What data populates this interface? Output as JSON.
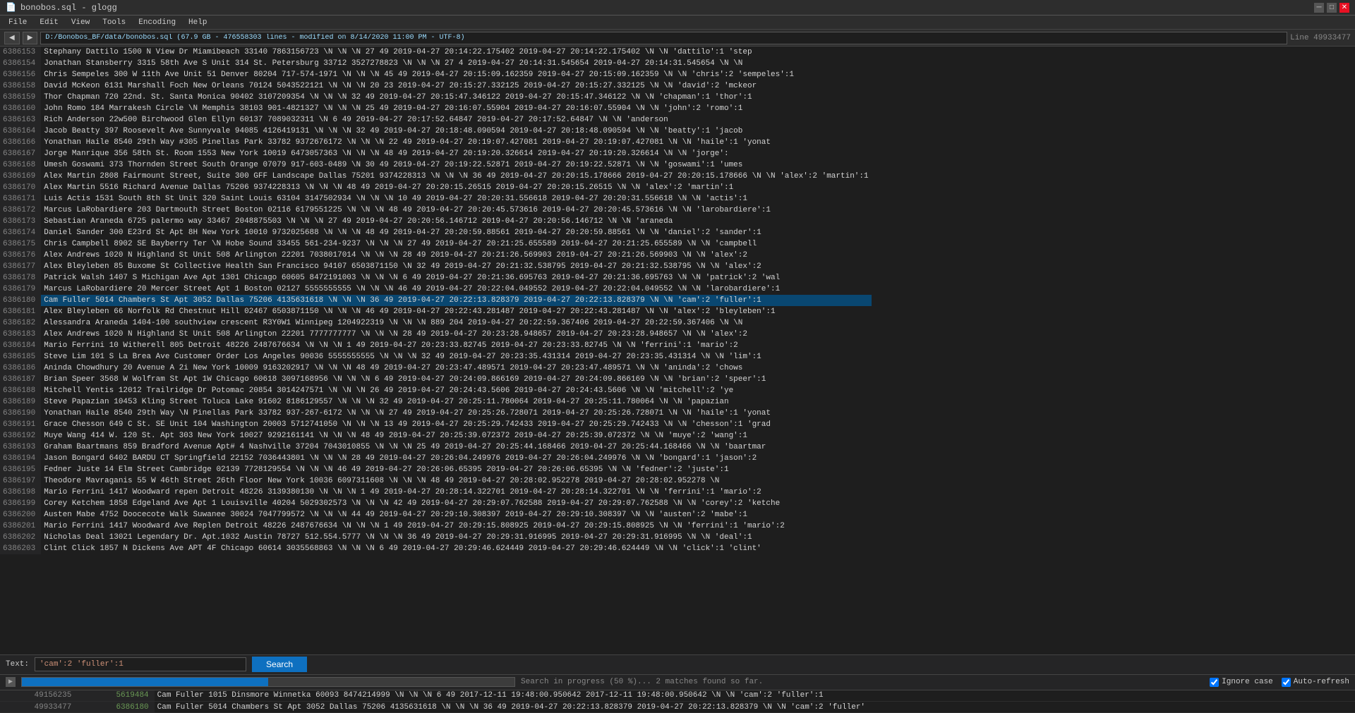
{
  "titleBar": {
    "title": "bonobos.sql - glogg",
    "minimizeLabel": "─",
    "maximizeLabel": "□",
    "closeLabel": "✕"
  },
  "menuBar": {
    "items": [
      "File",
      "Edit",
      "View",
      "Tools",
      "Encoding",
      "Help"
    ]
  },
  "toolbar": {
    "backLabel": "◀",
    "forwardLabel": "▶",
    "filePath": "D:/Bonobos_BF/data/bonobos.sql (67.9 GB - 476558303 lines - modified on 8/14/2020 11:00 PM - UTF-8)",
    "lineInfo": "Line 49933477"
  },
  "tableData": {
    "rows": [
      {
        "lineNum": "6386153",
        "data": "Stephany    Dattilo 1500 N View Dr          Miamibeach       33140   7863156723    \\N    \\N    \\N    27    49    2019-04-27 20:14:22.175402    2019-04-27 20:14:22.175402    \\N    \\N    'dattilo':1 'step"
      },
      {
        "lineNum": "6386154",
        "data": "Jonathan    Stansberry    3315 58th Ave S Unit 314    St. Petersburg    33712   3527278823    \\N    \\N    \\N    27    4    2019-04-27 20:14:31.545654    2019-04-27 20:14:31.545654    \\N    \\N"
      },
      {
        "lineNum": "6386156",
        "data": "Chris    Sempeles    300 W 11th Ave  Unit 51 Denver  80204   717-574-1971    \\N    \\N    \\N    45    49    2019-04-27 20:15:09.162359    2019-04-27 20:15:09.162359    \\N    \\N    'chris':2 'sempeles':1"
      },
      {
        "lineNum": "6386158",
        "data": "David    McKeon  6131 Marshall Foch    New Orleans    70124   5043522121    \\N    \\N    \\N    20    23    2019-04-27 20:15:27.332125    2019-04-27 20:15:27.332125    \\N    \\N    'david':2 'mckeor"
      },
      {
        "lineNum": "6386159",
        "data": "Thor    Chapman  720 22nd. St.    Santa Monica  90402   3107209354    \\N    \\N    \\N    32    49    2019-04-27 20:15:47.346122    2019-04-27 20:15:47.346122    \\N    \\N    'chapman':1 'thor':1"
      },
      {
        "lineNum": "6386160",
        "data": "John    Romo    184 Marrakesh Circle    \\N    Memphis 38103    901-4821327    \\N    \\N    \\N    25    49    2019-04-27 20:16:07.55904    2019-04-27 20:16:07.55904    \\N    \\N    'john':2 'romo':1"
      },
      {
        "lineNum": "6386163",
        "data": "Rich    Anderson    22w500 Birchwood    Glen Ellyn    60137   7089032311    \\N    6    49    2019-04-27 20:17:52.64847    2019-04-27 20:17:52.64847    \\N    \\N    'anderson"
      },
      {
        "lineNum": "6386164",
        "data": "Jacob    Beatty  397 Roosevelt Ave    Sunnyvale    94085   4126419131    \\N    \\N    \\N    32    49    2019-04-27 20:18:48.090594    2019-04-27 20:18:48.090594    \\N    \\N    'beatty':1 'jacob"
      },
      {
        "lineNum": "6386166",
        "data": "Yonathan    Haile    8540 29th Way    #305    Pinellas Park    33782   9372676172    \\N    \\N    \\N    22    49    2019-04-27 20:19:07.427081    2019-04-27 20:19:07.427081    \\N    \\N    'haile':1 'yonat"
      },
      {
        "lineNum": "6386167",
        "data": "Jorge    Manrique    356 58th St.    Room 1553    New York    10019   6473057363    \\N    \\N    \\N    48    49    2019-04-27 20:19:20.326614    2019-04-27 20:19:20.326614    \\N    \\N    'jorge':"
      },
      {
        "lineNum": "6386168",
        "data": "Umesh    Goswami 373 Thornden Street    South Orange    07079   917-603-0489    \\N    30    49    2019-04-27 20:19:22.52871    2019-04-27 20:19:22.52871    \\N    \\N    'goswami':1 'umes"
      },
      {
        "lineNum": "6386169",
        "data": "Alex    Martin  2808 Fairmount Street, Suite 300    GFF Landscape    Dallas  75201   9374228313    \\N    \\N    \\N    36    49    2019-04-27 20:20:15.178666    2019-04-27 20:20:15.178666    \\N    \\N    'alex':2 'martin':1"
      },
      {
        "lineNum": "6386170",
        "data": "Alex    Martin  5516 Richard Avenue    Dallas  75206   9374228313    \\N    \\N    \\N    48    49    2019-04-27 20:20:15.26515    2019-04-27 20:20:15.26515    \\N    \\N    'alex':2 'martin':1"
      },
      {
        "lineNum": "6386171",
        "data": "Luis    Actis   1531 South 8th St    Unit 320    Saint Louis    63104   3147502934    \\N    \\N    \\N    10    49    2019-04-27 20:20:31.556618    2019-04-27 20:20:31.556618    \\N    \\N    'actis':1"
      },
      {
        "lineNum": "6386172",
        "data": "Marcus    LaRobardiere    203 Dartmouth Street    Boston  02116   6179551225    \\N    \\N    \\N    48    49    2019-04-27 20:20:45.573616    2019-04-27 20:20:45.573616    \\N    \\N    'larobardiere':1"
      },
      {
        "lineNum": "6386173",
        "data": "Sebastian    Araneda 6725 palermo way    33467   2048875503    \\N    \\N    \\N    27    49    2019-04-27 20:20:56.146712    2019-04-27 20:20:56.146712    \\N    \\N    'araneda"
      },
      {
        "lineNum": "6386174",
        "data": "Daniel    Sander  300 E23rd St    Apt 8H New York    10010   9732025688    \\N    \\N    \\N    48    49    2019-04-27 20:20:59.88561    2019-04-27 20:20:59.88561    \\N    \\N    'daniel':2 'sander':1"
      },
      {
        "lineNum": "6386175",
        "data": "Chris    Campbell    8902 SE Bayberry Ter    \\N    Hobe Sound    33455   561-234-9237    \\N    \\N    \\N    27    49    2019-04-27 20:21:25.655589    2019-04-27 20:21:25.655589    \\N    \\N    'campbell"
      },
      {
        "lineNum": "6386176",
        "data": "Alex    Andrews 1020 N Highland St    Unit 508    Arlington    22201   7038017014    \\N    \\N    \\N    28    49    2019-04-27 20:21:26.569903    2019-04-27 20:21:26.569903    \\N    \\N    'alex':2"
      },
      {
        "lineNum": "6386177",
        "data": "Alex    Bleyleben    85 Buxome St    Collective Health    San Francisco    94107   6503871150    \\N    32    49    2019-04-27 20:21:32.538795    2019-04-27 20:21:32.538795    \\N    \\N    'alex':2"
      },
      {
        "lineNum": "6386178",
        "data": "Patrick Walsh    1407 S Michigan Ave    Apt 1301    Chicago 60605   8472191003    \\N    \\N    \\N    6    49    2019-04-27 20:21:36.695763    2019-04-27 20:21:36.695763    \\N    \\N    'patrick':2 'wal"
      },
      {
        "lineNum": "6386179",
        "data": "Marcus    LaRobardiere    20 Mercer Street    Apt 1    Boston  02127   5555555555    \\N    \\N    \\N    46    49    2019-04-27 20:22:04.049552    2019-04-27 20:22:04.049552    \\N    \\N    'larobardiere':1"
      },
      {
        "lineNum": "6386180",
        "data": "Cam    Fuller  5014 Chambers St    Apt 3052    Dallas  75206   4135631618    \\N    \\N    \\N    36    49    2019-04-27 20:22:13.828379    2019-04-27 20:22:13.828379    \\N    \\N    'cam':2 'fuller':1",
        "highlighted": true
      },
      {
        "lineNum": "6386181",
        "data": "Alex    Bleyleben    66 Norfolk Rd    Chestnut Hill    02467   6503871150    \\N    \\N    \\N    46    49    2019-04-27 20:22:43.281487    2019-04-27 20:22:43.281487    \\N    \\N    'alex':2 'bleyleben':1"
      },
      {
        "lineNum": "6386182",
        "data": "Alessandra    Araneda 1404-100 southview crescent    R3Y0W1    Winnipeg    1204922319    \\N    \\N    \\N    889    204    2019-04-27 20:22:59.367406    2019-04-27 20:22:59.367406    \\N    \\N"
      },
      {
        "lineNum": "6386183",
        "data": "Alex    Andrews 1020 N Highland St    Unit 508    Arlington    22201   7777777777    \\N    \\N    \\N    28    49    2019-04-27 20:23:28.948657    2019-04-27 20:23:28.948657    \\N    \\N    'alex':2"
      },
      {
        "lineNum": "6386184",
        "data": "Mario    Ferrini 10 Witherell    805    Detroit 48226   2487676634    \\N    \\N    \\N    1    49    2019-04-27 20:23:33.82745    2019-04-27 20:23:33.82745    \\N    \\N    'ferrini':1 'mario':2"
      },
      {
        "lineNum": "6386185",
        "data": "Steve    Lim    101 S La Brea Ave    Customer Order    Los Angeles    90036   5555555555    \\N    \\N    \\N    32    49    2019-04-27 20:23:35.431314    2019-04-27 20:23:35.431314    \\N    \\N    'lim':1"
      },
      {
        "lineNum": "6386186",
        "data": "Aninda    Chowdhury    20 Avenue A    2i    New York    10009   9163202917    \\N    \\N    \\N    48    49    2019-04-27 20:23:47.489571    2019-04-27 20:23:47.489571    \\N    \\N    'aninda':2 'chows"
      },
      {
        "lineNum": "6386187",
        "data": "Brian    Speer    3568 W Wolfram St    Apt 1W Chicago 60618   3097168956    \\N    \\N    \\N    6    49    2019-04-27 20:24:09.866169    2019-04-27 20:24:09.866169    \\N    \\N    'brian':2 'speer':1"
      },
      {
        "lineNum": "6386188",
        "data": "Mitchell    Yentis 12012 Trailridge Dr    Potomac 20854   3014247571    \\N    \\N    \\N    26    49    2019-04-27 20:24:43.5606    2019-04-27 20:24:43.5606    \\N    \\N    'mitchell':2 'ye"
      },
      {
        "lineNum": "6386189",
        "data": "Steve    Papazian    10453 Kling Street    Toluca Lake    91602   8186129557    \\N    \\N    \\N    32    49    2019-04-27 20:25:11.780064    2019-04-27 20:25:11.780064    \\N    \\N    'papazian"
      },
      {
        "lineNum": "6386190",
        "data": "Yonathan    Haile    8540 29th Way    \\N    Pinellas Park    33782   937-267-6172    \\N    \\N    \\N    27    49    2019-04-27 20:25:26.728071    2019-04-27 20:25:26.728071    \\N    \\N    'haile':1 'yonat"
      },
      {
        "lineNum": "6386191",
        "data": "Grace    Chesson 649 C St. SE    Unit 104    Washington    20003   5712741050    \\N    \\N    \\N    13    49    2019-04-27 20:25:29.742433    2019-04-27 20:25:29.742433    \\N    \\N    'chesson':1 'grad"
      },
      {
        "lineNum": "6386192",
        "data": "Muye    Wang    414 W. 120 St.    Apt 303 New York    10027   9292161141    \\N    \\N    \\N    48    49    2019-04-27 20:25:39.072372    2019-04-27 20:25:39.072372    \\N    \\N    'muye':2 'wang':1"
      },
      {
        "lineNum": "6386193",
        "data": "Graham    Baartmans    859 Bradford Avenue    Apt# 4    Nashville    37204   7043010855    \\N    \\N    \\N    25    49    2019-04-27 20:25:44.168466    2019-04-27 20:25:44.168466    \\N    \\N    'baartmar"
      },
      {
        "lineNum": "6386194",
        "data": "Jason    Bongard 6402 BARDU CT    Springfield    22152   7036443801    \\N    \\N    \\N    28    49    2019-04-27 20:26:04.249976    2019-04-27 20:26:04.249976    \\N    \\N    'bongard':1 'jason':2"
      },
      {
        "lineNum": "6386195",
        "data": "Fedner    Juste    14 Elm Street    Cambridge    02139   7728129554    \\N    \\N    \\N    46    49    2019-04-27 20:26:06.65395    2019-04-27 20:26:06.65395    \\N    \\N    'fedner':2 'juste':1"
      },
      {
        "lineNum": "6386197",
        "data": "Theodore    Mavraganis    55 W 46th Street    26th Floor    New York    10036   6097311608    \\N    \\N    \\N    48    49    2019-04-27 20:28:02.952278    2019-04-27 20:28:02.952278    \\N"
      },
      {
        "lineNum": "6386198",
        "data": "Mario    Ferrini 1417 Woodward    repen    Detroit 48226   3139380130    \\N    \\N    \\N    1    49    2019-04-27 20:28:14.322701    2019-04-27 20:28:14.322701    \\N    \\N    'ferrini':1 'mario':2"
      },
      {
        "lineNum": "6386199",
        "data": "Corey    Ketchem 1858 Edgeland Ave Apt 1    Louisville    40204   5029302573    \\N    \\N    \\N    42    49    2019-04-27 20:29:07.762588    2019-04-27 20:29:07.762588    \\N    \\N    'corey':2 'ketche"
      },
      {
        "lineNum": "6386200",
        "data": "Austen    Mabe    4752 Doocecote Walk    Suwanee 30024   7047799572    \\N    \\N    \\N    44    49    2019-04-27 20:29:10.308397    2019-04-27 20:29:10.308397    \\N    \\N    'austen':2 'mabe':1"
      },
      {
        "lineNum": "6386201",
        "data": "Mario    Ferrini 1417 Woodward Ave    Replen    Detroit 48226   2487676634    \\N    \\N    \\N    1    49    2019-04-27 20:29:15.808925    2019-04-27 20:29:15.808925    \\N    \\N    'ferrini':1 'mario':2"
      },
      {
        "lineNum": "6386202",
        "data": "Nicholas    Deal    13021 Legendary Dr.    Apt.1032    Austin  78727   512.554.5777    \\N    \\N    \\N    36    49    2019-04-27 20:29:31.916995    2019-04-27 20:29:31.916995    \\N    \\N    'deal':1"
      },
      {
        "lineNum": "6386203",
        "data": "Clint    Click    1857 N Dickens Ave    APT 4F    Chicago 60614   3035568863    \\N    \\N    \\N    6    49    2019-04-27 20:29:46.624449    2019-04-27 20:29:46.624449    \\N    \\N    'click':1 'clint'"
      }
    ]
  },
  "searchBar": {
    "label": "Text:",
    "value": "'cam':2 'fuller':1",
    "buttonLabel": "Search"
  },
  "progressBar": {
    "text": "Search in progress (50 %)... 2 matches found so far.",
    "percent": 50
  },
  "searchOptions": {
    "ignoreCaseLabel": "Ignore case",
    "autoRefreshLabel": "Auto-refresh"
  },
  "resultsData": {
    "rows": [
      {
        "lineNum": "49156235",
        "lineNum2": "5619484",
        "data": "Cam    Fuller  1015 Dinsmore    Winnetka    60093   8474214999    \\N    \\N    \\N    6    49    2017-12-11 19:48:00.950642    2017-12-11 19:48:00.950642    \\N    \\N    'cam':2 'fuller':1"
      },
      {
        "lineNum": "49933477",
        "lineNum2": "6386180",
        "data": "Cam    Fuller  5014 Chambers St    Apt 3052    Dallas  75206   4135631618    \\N    \\N    \\N    36    49    2019-04-27 20:22:13.828379    2019-04-27 20:22:13.828379    \\N    \\N    'cam':2 'fuller'"
      }
    ]
  }
}
